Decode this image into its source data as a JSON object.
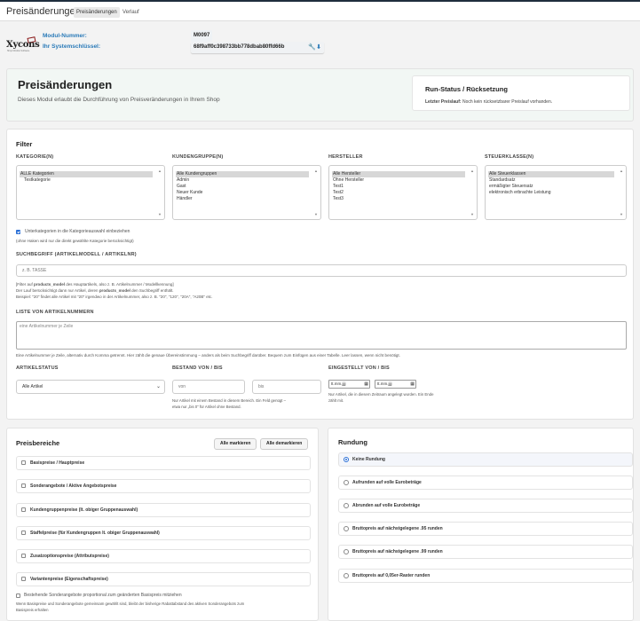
{
  "topbar": {
    "title": "Preisänderungen",
    "tabs": [
      "Preisänderungen",
      "Verlauf"
    ]
  },
  "logo": {
    "text": "Xycons",
    "sub": "Shop Module Software"
  },
  "module": {
    "number_label": "Modul-Nummer:",
    "number_value": "M0097",
    "key_label": "Ihr Systemschlüssel:",
    "key_value": "68f9aff0c398733bb778dbab80ffd66b"
  },
  "hero": {
    "title": "Preisänderungen",
    "subtitle": "Dieses Modul erlaubt die Durchführung von Preisveränderungen in Ihrem Shop",
    "run_title": "Run-Status / Rücksetzung",
    "run_label": "Letzter Preislauf:",
    "run_value": "Noch kein rücksetzbarer Preislauf vorhanden."
  },
  "filter": {
    "title": "Filter",
    "kategorie": {
      "label": "KATEGORIE(N)",
      "options": [
        "ALLE Kategorien",
        "Testkategorie"
      ]
    },
    "kundengruppe": {
      "label": "KUNDENGRUPPE(N)",
      "options": [
        "Alle Kundengruppen",
        "Admin",
        "Gast",
        "Neuer Kunde",
        "Händler"
      ]
    },
    "hersteller": {
      "label": "HERSTELLER",
      "options": [
        "Alle Hersteller",
        "Ohne Hersteller",
        "Test1",
        "Test2",
        "Test3"
      ]
    },
    "steuerklasse": {
      "label": "STEUERKLASSE(N)",
      "options": [
        "Alle Steuerklassen",
        "Standardsatz",
        "ermäßigter Steuersatz",
        "elektronisch erbrachte Leistung"
      ]
    },
    "subcat_label": "Unterkategorien in die Kategorieauswahl einbeziehen",
    "subcat_hint": "(ohne Haken wird nur die direkt gewählte Kategorie berücksichtigt)",
    "search_label": "SUCHBEGRIFF (ARTIKELMODELL / ARTIKELNR)",
    "search_placeholder": "z. B. TASSE",
    "search_help1_a": "[Filter auf ",
    "search_help1_b": "products_model",
    "search_help1_c": " des Hauptartikels, also z. B. Artikelnummer / Modellkennung]",
    "search_help2_a": "Der Lauf berücksichtigt dann nur Artikel, deren ",
    "search_help2_b": "products_model",
    "search_help2_c": " den Suchbegriff enthält.",
    "search_help3": "Beispiel: \"20\" findet alle Artikel mit \"20\" irgendwo in der Artikelnummer, also z. B. \"20\", \"120\", \"20A\", \"A20B\" etc.",
    "list_label": "LISTE VON ARTIKELNUMMERN",
    "list_placeholder": "eine Artikelnummer je Zeile",
    "list_help": "Eine Artikelnummer je Zeile, alternativ durch Komma getrennt. Hier zählt die genaue Übereinstimmung – anders als beim Suchbegriff darüber. Bequem zum Einfügen aus einer Tabelle. Leer lassen, wenn nicht benötigt.",
    "status_label": "ARTIKELSTATUS",
    "status_value": "Alle Artikel",
    "bestand_label": "BESTAND VON / BIS",
    "bestand_von": "von",
    "bestand_bis": "bis",
    "bestand_help1": "Nur Artikel mit einem Bestand in diesem Bereich. Ein Feld genügt –",
    "bestand_help2": "etwa nur „bis 0\" für Artikel ohne Bestand.",
    "eingestellt_label": "EINGESTELLT VON / BIS",
    "date_placeholder": "tt.mm.jjjj",
    "eingestellt_help1": "Nur Artikel, die in diesem Zeitraum angelegt wurden. Ein Ende",
    "eingestellt_help2": "zählt mit."
  },
  "preisbereiche": {
    "title": "Preisbereiche",
    "mark_all": "Alle markieren",
    "unmark_all": "Alle demarkieren",
    "items": [
      "Basispreise / Hauptpreise",
      "Sonderangebote / Aktive Angebotspreise",
      "Kundengruppenpreise (lt. obiger Gruppenauswahl)",
      "Staffelpreise (für Kundengruppen lt. obiger Gruppenauswahl)",
      "Zusatzoptionspreise (Attributspreise)",
      "Variantenpreise (Eigenschaftspreise)"
    ],
    "prop_label": "Bestehende Sonderangebote proportional zum geänderten Basispreis mitziehen",
    "prop_help1": "Wenn Basispreise und Sonderangebote gemeinsam gewählt sind, bleibt der bisherige Rabattabstand des aktiven Sonderangebots zum",
    "prop_help2": "Basispreis erhalten"
  },
  "rundung": {
    "title": "Rundung",
    "items": [
      "Keine Rundung",
      "Aufrunden auf volle Eurobeträge",
      "Abrunden auf volle Eurobeträge",
      "Bruttopreis auf nächstgelegene .95 runden",
      "Bruttopreis auf nächstgelegene .99 runden",
      "Bruttopreis auf 0,05er-Raster runden"
    ],
    "selected_index": 0
  },
  "colors": {
    "accent": "#2a7ab8",
    "checkbox": "#2a6fd6",
    "hero_bg": "#f2f7f4"
  }
}
